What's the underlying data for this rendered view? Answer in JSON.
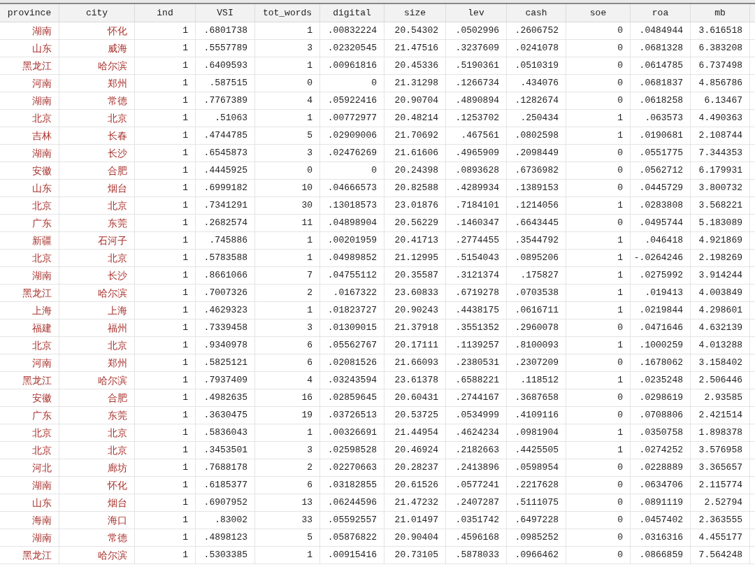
{
  "table": {
    "columns": [
      "province",
      "city",
      "ind",
      "VSI",
      "tot_words",
      "digital",
      "size",
      "lev",
      "cash",
      "soe",
      "roa",
      "mb"
    ],
    "rows": [
      [
        "湖南",
        "怀化",
        "1",
        ".6801738",
        "1",
        ".00832224",
        "20.54302",
        ".0502996",
        ".2606752",
        "0",
        ".0484944",
        "3.616518"
      ],
      [
        "山东",
        "威海",
        "1",
        ".5557789",
        "3",
        ".02320545",
        "21.47516",
        ".3237609",
        ".0241078",
        "0",
        ".0681328",
        "6.383208"
      ],
      [
        "黑龙江",
        "哈尔滨",
        "1",
        ".6409593",
        "1",
        ".00961816",
        "20.45336",
        ".5190361",
        ".0510319",
        "0",
        ".0614785",
        "6.737498"
      ],
      [
        "河南",
        "郑州",
        "1",
        ".587515",
        "0",
        "0",
        "21.31298",
        ".1266734",
        ".434076",
        "0",
        ".0681837",
        "4.856786"
      ],
      [
        "湖南",
        "常德",
        "1",
        ".7767389",
        "4",
        ".05922416",
        "20.90704",
        ".4890894",
        ".1282674",
        "0",
        ".0618258",
        "6.13467"
      ],
      [
        "北京",
        "北京",
        "1",
        ".51063",
        "1",
        ".00772977",
        "20.48214",
        ".1253702",
        ".250434",
        "1",
        ".063573",
        "4.490363"
      ],
      [
        "吉林",
        "长春",
        "1",
        ".4744785",
        "5",
        ".02909006",
        "21.70692",
        ".467561",
        ".0802598",
        "1",
        ".0190681",
        "2.108744"
      ],
      [
        "湖南",
        "长沙",
        "1",
        ".6545873",
        "3",
        ".02476269",
        "21.61606",
        ".4965909",
        ".2098449",
        "0",
        ".0551775",
        "7.344353"
      ],
      [
        "安徽",
        "合肥",
        "1",
        ".4445925",
        "0",
        "0",
        "20.24398",
        ".0893628",
        ".6736982",
        "0",
        ".0562712",
        "6.179931"
      ],
      [
        "山东",
        "烟台",
        "1",
        ".6999182",
        "10",
        ".04666573",
        "20.82588",
        ".4289934",
        ".1389153",
        "0",
        ".0445729",
        "3.800732"
      ],
      [
        "北京",
        "北京",
        "1",
        ".7341291",
        "30",
        ".13018573",
        "23.01876",
        ".7184101",
        ".1214056",
        "1",
        ".0283808",
        "3.568221"
      ],
      [
        "广东",
        "东莞",
        "1",
        ".2682574",
        "11",
        ".04898904",
        "20.56229",
        ".1460347",
        ".6643445",
        "0",
        ".0495744",
        "5.183089"
      ],
      [
        "新疆",
        "石河子",
        "1",
        ".745886",
        "1",
        ".00201959",
        "20.41713",
        ".2774455",
        ".3544792",
        "1",
        ".046418",
        "4.921869"
      ],
      [
        "北京",
        "北京",
        "1",
        ".5783588",
        "1",
        ".04989852",
        "21.12995",
        ".5154043",
        ".0895206",
        "1",
        "-.0264246",
        "2.198269"
      ],
      [
        "湖南",
        "长沙",
        "1",
        ".8661066",
        "7",
        ".04755112",
        "20.35587",
        ".3121374",
        ".175827",
        "1",
        ".0275992",
        "3.914244"
      ],
      [
        "黑龙江",
        "哈尔滨",
        "1",
        ".7007326",
        "2",
        ".0167322",
        "23.60833",
        ".6719278",
        ".0703538",
        "1",
        ".019413",
        "4.003849"
      ],
      [
        "上海",
        "上海",
        "1",
        ".4629323",
        "1",
        ".01823727",
        "20.90243",
        ".4438175",
        ".0616711",
        "1",
        ".0219844",
        "4.298601"
      ],
      [
        "福建",
        "福州",
        "1",
        ".7339458",
        "3",
        ".01309015",
        "21.37918",
        ".3551352",
        ".2960078",
        "0",
        ".0471646",
        "4.632139"
      ],
      [
        "北京",
        "北京",
        "1",
        ".9340978",
        "6",
        ".05562767",
        "20.17111",
        ".1139257",
        ".8100093",
        "1",
        ".1000259",
        "4.013288"
      ],
      [
        "河南",
        "郑州",
        "1",
        ".5825121",
        "6",
        ".02081526",
        "21.66093",
        ".2380531",
        ".2307209",
        "0",
        ".1678062",
        "3.158402"
      ],
      [
        "黑龙江",
        "哈尔滨",
        "1",
        ".7937409",
        "4",
        ".03243594",
        "23.61378",
        ".6588221",
        ".118512",
        "1",
        ".0235248",
        "2.506446"
      ],
      [
        "安徽",
        "合肥",
        "1",
        ".4982635",
        "16",
        ".02859645",
        "20.60431",
        ".2744167",
        ".3687658",
        "0",
        ".0298619",
        "2.93585"
      ],
      [
        "广东",
        "东莞",
        "1",
        ".3630475",
        "19",
        ".03726513",
        "20.53725",
        ".0534999",
        ".4109116",
        "0",
        ".0708806",
        "2.421514"
      ],
      [
        "北京",
        "北京",
        "1",
        ".5836043",
        "1",
        ".00326691",
        "21.44954",
        ".4624234",
        ".0981904",
        "1",
        ".0350758",
        "1.898378"
      ],
      [
        "北京",
        "北京",
        "1",
        ".3453501",
        "3",
        ".02598528",
        "20.46924",
        ".2182663",
        ".4425505",
        "1",
        ".0274252",
        "3.576958"
      ],
      [
        "河北",
        "廊坊",
        "1",
        ".7688178",
        "2",
        ".02270663",
        "20.28237",
        ".2413896",
        ".0598954",
        "0",
        ".0228889",
        "3.365657"
      ],
      [
        "湖南",
        "怀化",
        "1",
        ".6185377",
        "6",
        ".03182855",
        "20.61526",
        ".0577241",
        ".2217628",
        "0",
        ".0634706",
        "2.115774"
      ],
      [
        "山东",
        "烟台",
        "1",
        ".6907952",
        "13",
        ".06244596",
        "21.47232",
        ".2407287",
        ".5111075",
        "0",
        ".0891119",
        "2.52794"
      ],
      [
        "海南",
        "海口",
        "1",
        ".83002",
        "33",
        ".05592557",
        "21.01497",
        ".0351742",
        ".6497228",
        "0",
        ".0457402",
        "2.363555"
      ],
      [
        "湖南",
        "常德",
        "1",
        ".4898123",
        "5",
        ".05876822",
        "20.90404",
        ".4596168",
        ".0985252",
        "0",
        ".0316316",
        "4.455177"
      ],
      [
        "黑龙江",
        "哈尔滨",
        "1",
        ".5303385",
        "1",
        ".00915416",
        "20.73105",
        ".5878033",
        ".0966462",
        "0",
        ".0866859",
        "7.564248"
      ]
    ]
  }
}
